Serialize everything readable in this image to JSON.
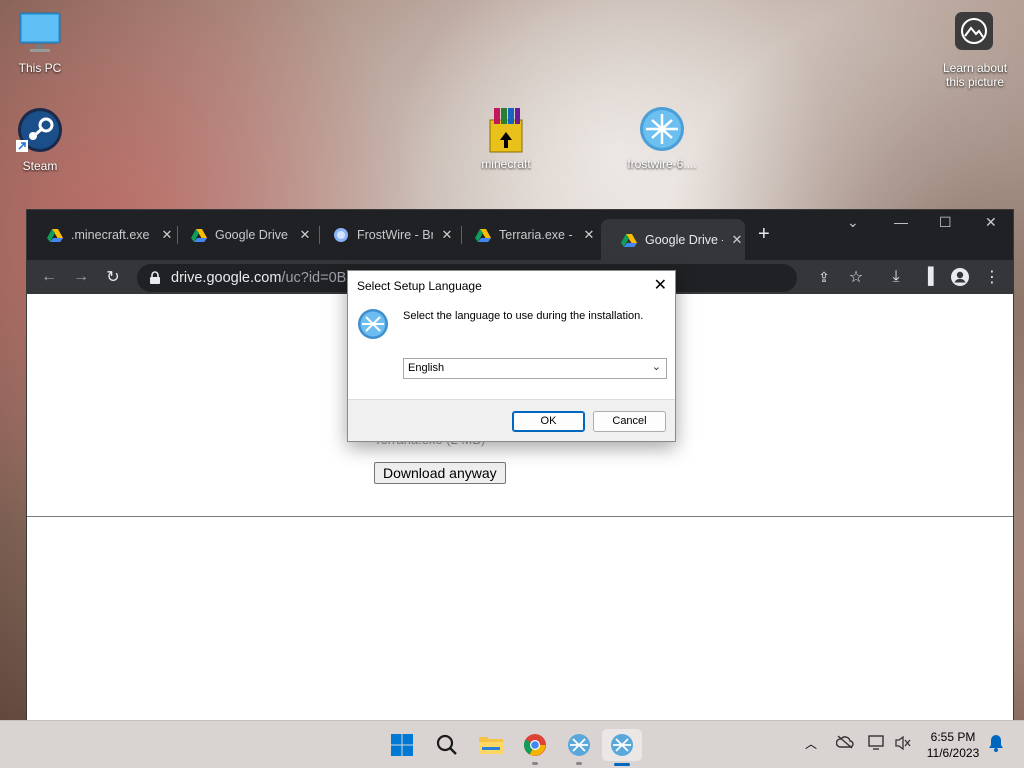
{
  "desktop": {
    "icons": [
      {
        "label": "This PC"
      },
      {
        "label": "Steam"
      },
      {
        "label": "minecraft"
      },
      {
        "label": "frostwire-6...."
      },
      {
        "label": "Learn about this picture"
      }
    ]
  },
  "browser": {
    "tabs": [
      {
        "title": ".minecraft.exe",
        "favicon": "google-drive-icon"
      },
      {
        "title": "Google Drive -",
        "favicon": "google-drive-icon"
      },
      {
        "title": "FrostWire - Bri",
        "favicon": "globe-icon"
      },
      {
        "title": "Terraria.exe - G",
        "favicon": "google-drive-icon"
      },
      {
        "title": "Google Drive -",
        "favicon": "google-drive-icon"
      }
    ],
    "url_host": "drive.google.com",
    "url_rest": "/uc?id=0B3",
    "page": {
      "faint_text": "Terraria.exe (2 MB)",
      "download_button": "Download anyway"
    }
  },
  "dialog": {
    "title": "Select Setup Language",
    "message": "Select the language to use during the installation.",
    "selected_language": "English",
    "ok_label": "OK",
    "cancel_label": "Cancel"
  },
  "taskbar": {
    "time": "6:55 PM",
    "date": "11/6/2023"
  },
  "colors": {
    "chrome_dark": "#202124",
    "chrome_toolbar": "#35363a",
    "accent": "#0067c0"
  }
}
